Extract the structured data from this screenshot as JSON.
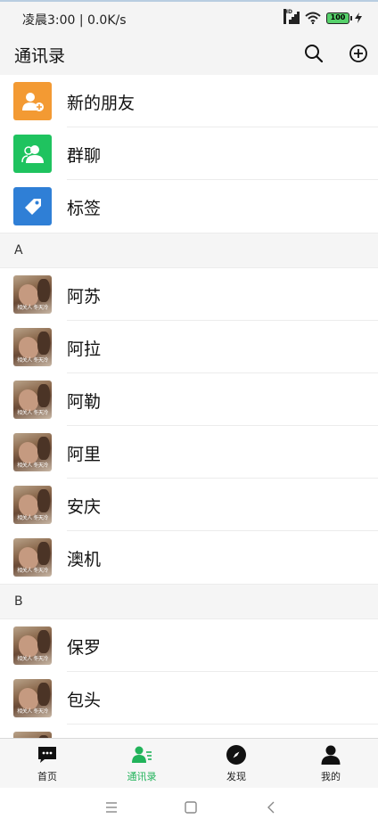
{
  "status_bar": {
    "time_speed": "凌晨3:00 | 0.0K/s",
    "network_badge": "HD",
    "battery": "100"
  },
  "header": {
    "title": "通讯录",
    "search_icon": "search-icon",
    "add_icon": "plus-circle-icon"
  },
  "functions": [
    {
      "label": "新的朋友",
      "icon": "add-friend-icon",
      "color": "#f39a33"
    },
    {
      "label": "群聊",
      "icon": "group-chat-icon",
      "color": "#1fc35f"
    },
    {
      "label": "标签",
      "icon": "tag-icon",
      "color": "#2f7fd6"
    }
  ],
  "sections": [
    {
      "letter": "A",
      "contacts": [
        "阿苏",
        "阿拉",
        "阿勒",
        "阿里",
        "安庆",
        "澳机"
      ]
    },
    {
      "letter": "B",
      "contacts": [
        "保罗",
        "包头"
      ]
    }
  ],
  "avatar_caption": "相关人   冬天冷",
  "bottom_nav": [
    {
      "label": "首页",
      "icon": "chat-bubble-icon",
      "active": false
    },
    {
      "label": "通讯录",
      "icon": "contacts-icon",
      "active": true
    },
    {
      "label": "发现",
      "icon": "compass-icon",
      "active": false
    },
    {
      "label": "我的",
      "icon": "person-icon",
      "active": false
    }
  ],
  "colors": {
    "accent": "#21b35a",
    "header_bg": "#f4f4f4"
  }
}
